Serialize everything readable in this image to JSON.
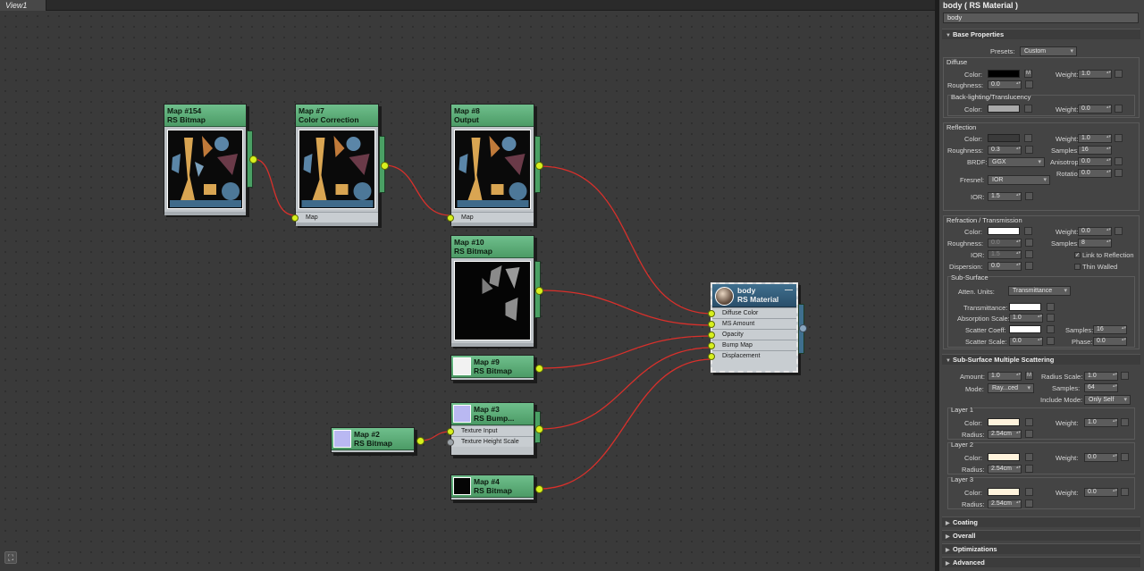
{
  "view": {
    "tab_label": "View1"
  },
  "nodes": {
    "map154": {
      "id": "Map #154",
      "type": "RS Bitmap"
    },
    "map7": {
      "id": "Map #7",
      "type": "Color Correction",
      "slot": "Map"
    },
    "map8": {
      "id": "Map #8",
      "type": "Output",
      "slot": "Map"
    },
    "map10": {
      "id": "Map #10",
      "type": "RS Bitmap"
    },
    "map9": {
      "id": "Map #9",
      "type": "RS Bitmap"
    },
    "map3": {
      "id": "Map #3",
      "type": "RS Bump...",
      "slots": [
        "Texture Input",
        "Texture Height Scale"
      ]
    },
    "map2": {
      "id": "Map #2",
      "type": "RS Bitmap"
    },
    "map4": {
      "id": "Map #4",
      "type": "RS Bitmap"
    },
    "material": {
      "name": "body",
      "type": "RS Material",
      "minimize": "—",
      "slots": [
        "Diffuse Color",
        "MS Amount",
        "Opacity",
        "Bump Map",
        "Displacement"
      ]
    }
  },
  "panel": {
    "title": "body  ( RS Material )",
    "name_value": "body",
    "base": {
      "header": "Base Properties",
      "presets_label": "Presets:",
      "presets_value": "Custom",
      "diffuse": {
        "group": "Diffuse",
        "color": "Color:",
        "m": "M",
        "weight": "Weight:",
        "weight_val": "1.0",
        "rough": "Roughness:",
        "rough_val": "0.0",
        "backlight": "Back-lighting/Translucency",
        "bl_color": "Color:",
        "bl_weight": "Weight:",
        "bl_weight_val": "0.0"
      },
      "reflection": {
        "group": "Reflection",
        "color": "Color:",
        "weight": "Weight:",
        "weight_val": "1.0",
        "rough": "Roughness:",
        "rough_val": "0.3",
        "samples": "Samples:",
        "samples_val": "16",
        "brdf": "BRDF:",
        "brdf_val": "GGX",
        "aniso": "Anisotropy",
        "aniso_val": "0.0",
        "rotation": "Rotation:",
        "rotation_val": "0.0",
        "fresnel": "Fresnel:",
        "fresnel_val": "IOR",
        "ior": "IOR:",
        "ior_val": "1.5"
      },
      "refraction": {
        "group": "Refraction / Transmission",
        "color": "Color:",
        "weight": "Weight:",
        "weight_val": "0.0",
        "rough": "Roughness:",
        "rough_val": "0.0",
        "samples": "Samples:",
        "samples_val": "8",
        "ior": "IOR:",
        "ior_val": "1.5",
        "link": "Link to Reflection",
        "disp": "Dispersion:",
        "disp_val": "0.0",
        "thin": "Thin Walled"
      },
      "subsurface": {
        "group": "Sub-Surface",
        "atten": "Atten. Units:",
        "atten_val": "Transmittance",
        "trans": "Transmittance:",
        "abs": "Absorption Scale:",
        "abs_val": "1.0",
        "scatter": "Scatter Coeff:",
        "samples": "Samples:",
        "samples_val": "16",
        "scale": "Scatter Scale:",
        "scale_val": "0.0",
        "phase": "Phase:",
        "phase_val": "0.0"
      }
    },
    "sss": {
      "header": "Sub-Surface Multiple Scattering",
      "amount": "Amount:",
      "amount_val": "1.0",
      "m": "M",
      "radius_scale": "Radius Scale:",
      "radius_scale_val": "1.0",
      "mode": "Mode:",
      "mode_val": "Ray...ced",
      "samples": "Samples:",
      "samples_val": "64",
      "include": "Include Mode:",
      "include_val": "Only Self",
      "layers": [
        {
          "name": "Layer 1",
          "color": "Color:",
          "weight": "Weight:",
          "weight_val": "1.0",
          "radius": "Radius:",
          "radius_val": "2.54cm"
        },
        {
          "name": "Layer 2",
          "color": "Color:",
          "weight": "Weight:",
          "weight_val": "0.0",
          "radius": "Radius:",
          "radius_val": "2.54cm"
        },
        {
          "name": "Layer 3",
          "color": "Color:",
          "weight": "Weight:",
          "weight_val": "0.0",
          "radius": "Radius:",
          "radius_val": "2.54cm"
        }
      ]
    },
    "collapsed": [
      "Coating",
      "Overall",
      "Optimizations",
      "Advanced"
    ]
  },
  "colors": {
    "node_header": "#5aad77",
    "material_header": "#34607f",
    "wire": "#d8302b",
    "socket": "#d7f01e"
  }
}
